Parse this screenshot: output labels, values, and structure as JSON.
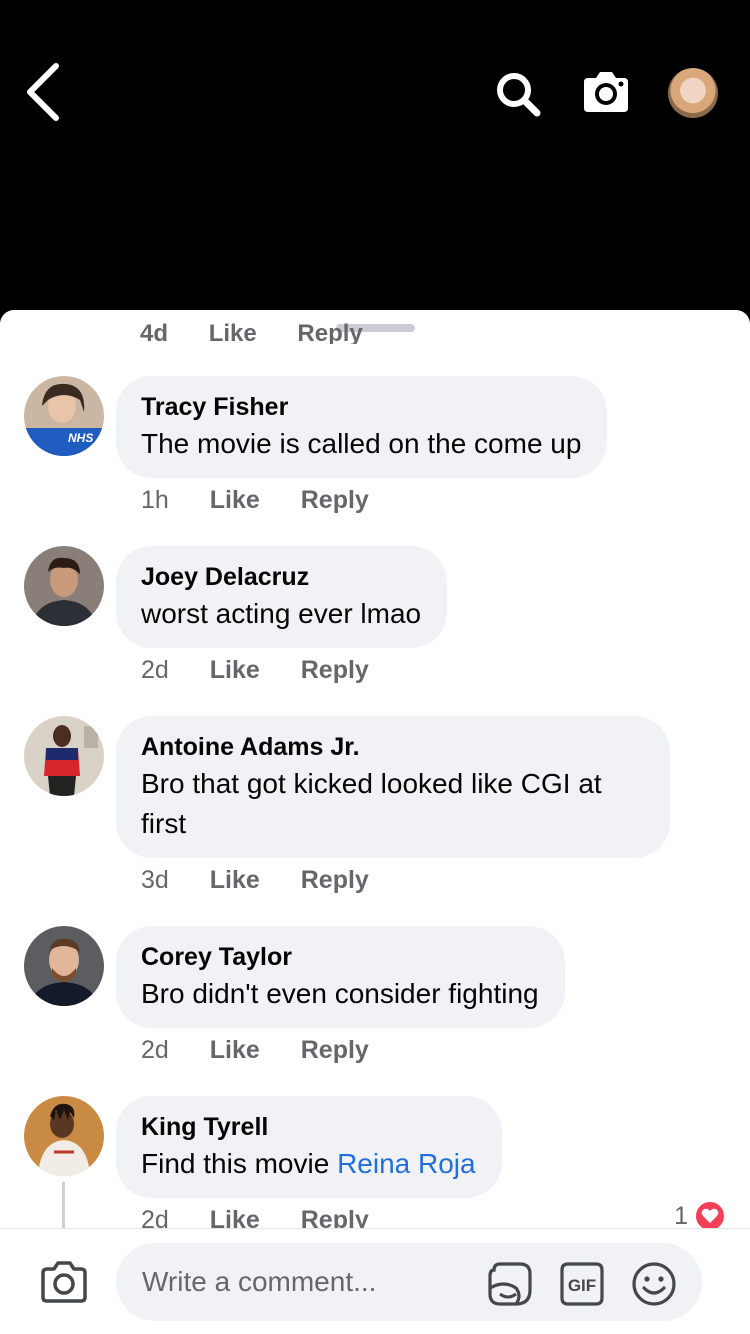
{
  "header": {
    "back_icon": "chevron-left-icon",
    "search_icon": "search-icon",
    "camera_icon": "camera-icon"
  },
  "cut_row": {
    "time": "4d",
    "like": "Like",
    "reply": "Reply"
  },
  "comments": [
    {
      "author": "Tracy Fisher",
      "text": "The movie is called on the come up",
      "time": "1h",
      "like": "Like",
      "reply": "Reply"
    },
    {
      "author": "Joey Delacruz",
      "text": "worst acting ever lmao",
      "time": "2d",
      "like": "Like",
      "reply": "Reply"
    },
    {
      "author": "Antoine Adams Jr.",
      "text": "Bro that got kicked looked like CGI at first",
      "time": "3d",
      "like": "Like",
      "reply": "Reply"
    },
    {
      "author": "Corey Taylor",
      "text": "Bro didn't even consider fighting",
      "time": "2d",
      "like": "Like",
      "reply": "Reply"
    },
    {
      "author": "King Tyrell",
      "text": "Find this movie ",
      "mention": "Reina Roja",
      "time": "2d",
      "like": "Like",
      "reply": "Reply",
      "reaction_count": "1"
    }
  ],
  "avatar_badge": "NHS",
  "composer": {
    "placeholder": "Write a comment...",
    "gif_label": "GIF"
  },
  "colors": {
    "mention": "#216fdb",
    "bubble": "#f0f2f5",
    "heart": "#f33e58"
  }
}
